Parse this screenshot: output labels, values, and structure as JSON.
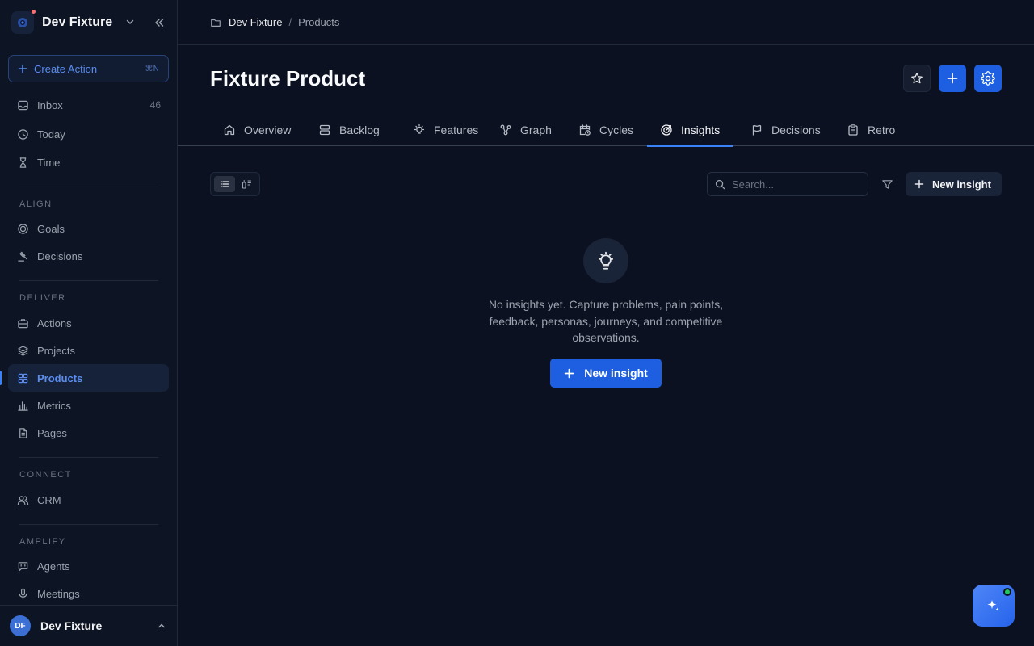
{
  "workspace": {
    "name": "Dev Fixture"
  },
  "create_action": {
    "label": "Create Action",
    "shortcut": "⌘N"
  },
  "nav": {
    "top": [
      {
        "label": "Inbox",
        "count": "46"
      },
      {
        "label": "Today"
      },
      {
        "label": "Time"
      }
    ],
    "sections": {
      "align": "ALIGN",
      "deliver": "DELIVER",
      "connect": "CONNECT",
      "amplify": "AMPLIFY"
    },
    "align": [
      "Goals",
      "Decisions"
    ],
    "deliver": [
      "Actions",
      "Projects",
      "Products",
      "Metrics",
      "Pages"
    ],
    "connect": [
      "CRM"
    ],
    "amplify": [
      "Agents",
      "Meetings"
    ],
    "active": "Products"
  },
  "user": {
    "initials": "DF",
    "name": "Dev Fixture"
  },
  "breadcrumb": {
    "root": "Dev Fixture",
    "separator": "/",
    "current": "Products"
  },
  "page": {
    "title": "Fixture Product"
  },
  "tabs": [
    {
      "label": "Overview"
    },
    {
      "label": "Backlog"
    },
    {
      "label": "Features"
    },
    {
      "label": "Graph"
    },
    {
      "label": "Cycles"
    },
    {
      "label": "Insights",
      "active": true
    },
    {
      "label": "Decisions"
    },
    {
      "label": "Retro"
    }
  ],
  "toolbar": {
    "search_placeholder": "Search...",
    "new_insight_label": "New insight"
  },
  "empty_state": {
    "icon": "lightbulb-icon",
    "message": "No insights yet. Capture problems, pain points, feedback, personas, journeys, and competitive observations.",
    "button_label": "New insight"
  },
  "colors": {
    "accent": "#1d5fe0",
    "background": "#0b1120",
    "sidebar": "#0d1424",
    "status_online": "#22c55e"
  }
}
